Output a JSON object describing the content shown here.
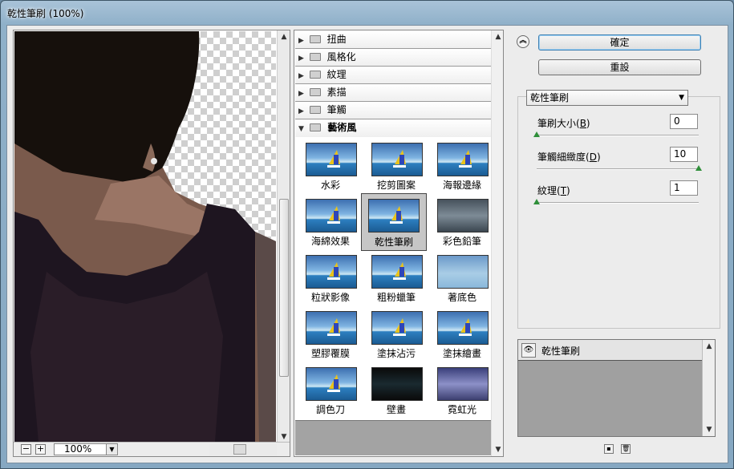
{
  "window": {
    "title": "乾性筆刷 (100%)"
  },
  "preview": {
    "zoom": "100%",
    "zoom_out": "−",
    "zoom_in": "+"
  },
  "categories": [
    {
      "label": "扭曲"
    },
    {
      "label": "風格化"
    },
    {
      "label": "紋理"
    },
    {
      "label": "素描"
    },
    {
      "label": "筆觸"
    }
  ],
  "open_category": {
    "label": "藝術風"
  },
  "filters": [
    {
      "label": "水彩"
    },
    {
      "label": "挖剪圖案"
    },
    {
      "label": "海報邊緣"
    },
    {
      "label": "海綿效果"
    },
    {
      "label": "乾性筆刷"
    },
    {
      "label": "彩色鉛筆"
    },
    {
      "label": "粒狀影像"
    },
    {
      "label": "粗粉蠟筆"
    },
    {
      "label": "著底色"
    },
    {
      "label": "塑膠覆膜"
    },
    {
      "label": "塗抹沾污"
    },
    {
      "label": "塗抹繪畫"
    },
    {
      "label": "調色刀"
    },
    {
      "label": "壁畫"
    },
    {
      "label": "霓虹光"
    }
  ],
  "buttons": {
    "ok": "確定",
    "reset": "重設"
  },
  "settings": {
    "selected_filter": "乾性筆刷",
    "params": [
      {
        "label_pre": "筆刷大小(",
        "key": "B",
        "label_post": ")",
        "value": "0",
        "level": 0
      },
      {
        "label_pre": "筆觸細緻度(",
        "key": "D",
        "label_post": ")",
        "value": "10",
        "level": 1
      },
      {
        "label_pre": "紋理(",
        "key": "T",
        "label_post": ")",
        "value": "1",
        "level": 0
      }
    ]
  },
  "layers": {
    "name": "乾性筆刷"
  }
}
